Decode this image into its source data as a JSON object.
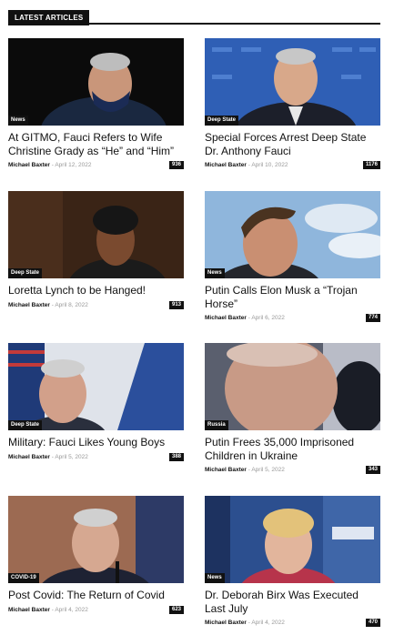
{
  "section": {
    "title": "LATEST ARTICLES"
  },
  "articles": [
    {
      "category": "News",
      "title": "At GITMO, Fauci Refers to Wife Christine Grady as “He” and “Him”",
      "author": "Michael Baxter",
      "separator": "-",
      "date": "April 12, 2022",
      "count": "936"
    },
    {
      "category": "Deep State",
      "title": "Special Forces Arrest Deep State Dr. Anthony Fauci",
      "author": "Michael Baxter",
      "separator": "-",
      "date": "April 10, 2022",
      "count": "1176"
    },
    {
      "category": "Deep State",
      "title": "Loretta Lynch to be Hanged!",
      "author": "Michael Baxter",
      "separator": "-",
      "date": "April 8, 2022",
      "count": "913"
    },
    {
      "category": "News",
      "title": "Putin Calls Elon Musk a “Trojan Horse”",
      "author": "Michael Baxter",
      "separator": "-",
      "date": "April 6, 2022",
      "count": "774"
    },
    {
      "category": "Deep State",
      "title": "Military: Fauci Likes Young Boys",
      "author": "Michael Baxter",
      "separator": "-",
      "date": "April 5, 2022",
      "count": "388"
    },
    {
      "category": "Russia",
      "title": "Putin Frees 35,000 Imprisoned Children in Ukraine",
      "author": "Michael Baxter",
      "separator": "-",
      "date": "April 5, 2022",
      "count": "343"
    },
    {
      "category": "COVID-19",
      "title": "Post Covid: The Return of Covid",
      "author": "Michael Baxter",
      "separator": "-",
      "date": "April 4, 2022",
      "count": "623"
    },
    {
      "category": "News",
      "title": "Dr. Deborah Birx Was Executed Last July",
      "author": "Michael Baxter",
      "separator": "-",
      "date": "April 4, 2022",
      "count": "470"
    }
  ]
}
